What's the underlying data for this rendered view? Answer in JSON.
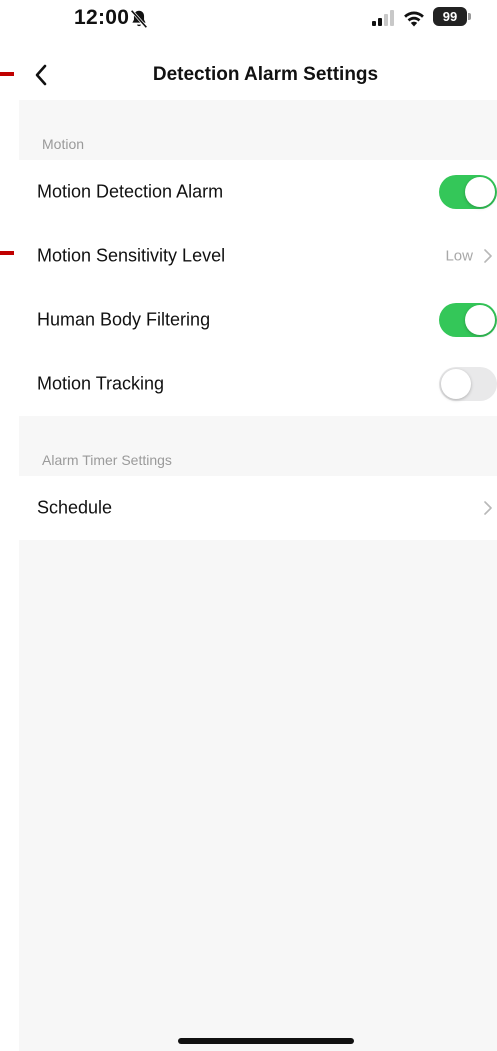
{
  "status_bar": {
    "time": "12:00",
    "battery": "99",
    "icons": [
      "bell-slash-icon",
      "signal-icon",
      "wifi-icon",
      "battery-icon"
    ]
  },
  "nav": {
    "title": "Detection Alarm Settings",
    "back_icon": "chevron-left-icon"
  },
  "sections": {
    "motion": {
      "header": "Motion",
      "rows": {
        "motion_detection_alarm": {
          "label": "Motion Detection Alarm",
          "toggle": true
        },
        "motion_sensitivity_level": {
          "label": "Motion Sensitivity Level",
          "value": "Low"
        },
        "human_body_filtering": {
          "label": "Human Body Filtering",
          "toggle": true
        },
        "motion_tracking": {
          "label": "Motion Tracking",
          "toggle": false
        }
      }
    },
    "alarm_timer": {
      "header": "Alarm Timer Settings",
      "rows": {
        "schedule": {
          "label": "Schedule"
        }
      }
    }
  },
  "colors": {
    "toggle_on": "#34c759",
    "toggle_off": "#e9e9ea",
    "marker": "#c00000",
    "background": "#f7f7f7"
  }
}
